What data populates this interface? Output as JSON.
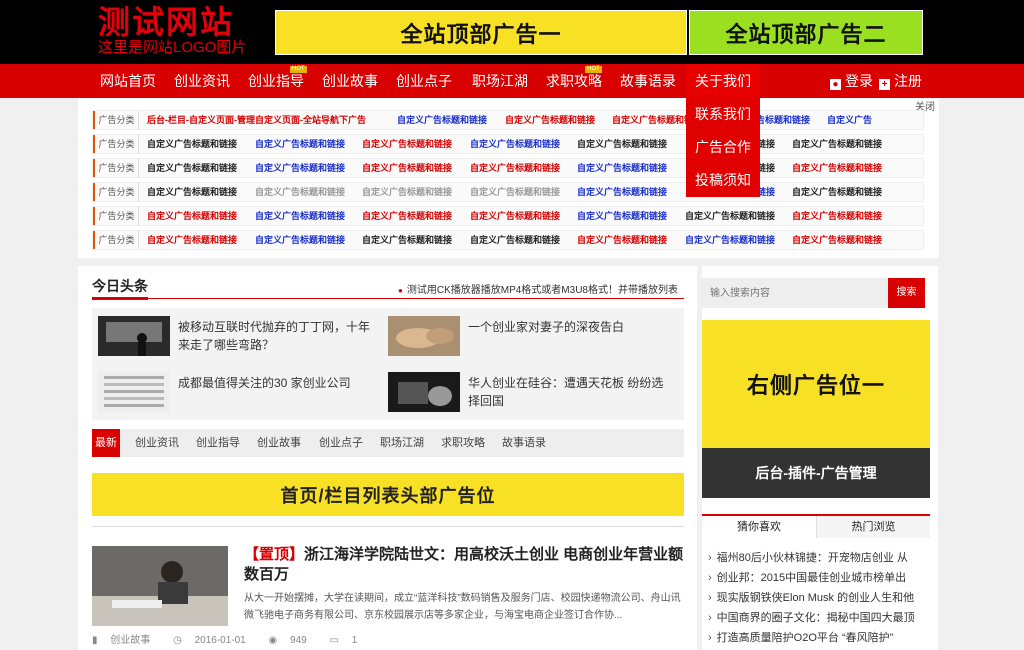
{
  "logo": {
    "title": "测试网站",
    "subtitle": "这里是网站LOGO图片"
  },
  "top_ads": {
    "ad1": "全站顶部广告一",
    "ad2": "全站顶部广告二"
  },
  "nav": {
    "items": [
      "网站首页",
      "创业资讯",
      "创业指导",
      "创业故事",
      "创业点子",
      "职场江湖",
      "求职攻略",
      "故事语录",
      "关于我们"
    ],
    "hot_tag": "HOT",
    "login": "登录",
    "register": "注册"
  },
  "dropdown": {
    "items": [
      "联系我们",
      "广告合作",
      "投稿须知"
    ]
  },
  "ad_panel": {
    "close": "关闭",
    "category": "广告分类",
    "row1_first": "后台-栏目-自定义页面-管理自定义页面-全站导航下广告",
    "link": "自定义广告标题和链接",
    "short_link": "自定义广告"
  },
  "headlines": {
    "title": "今日头条",
    "ticker": "测试用CK播放器播放MP4格式或者M3U8格式！并带播放列表",
    "items": [
      "被移动互联时代抛弃的丁丁网，十年来走了哪些弯路？",
      "一个创业家对妻子的深夜告白",
      "成都最值得关注的30 家创业公司",
      "华人创业在硅谷：遭遇天花板 纷纷选择回国"
    ]
  },
  "category_bar": {
    "latest": "最新",
    "items": [
      "创业资讯",
      "创业指导",
      "创业故事",
      "创业点子",
      "职场江湖",
      "求职攻略",
      "故事语录"
    ]
  },
  "banner_ad": "首页/栏目列表头部广告位",
  "article": {
    "pin": "【置顶】",
    "title": "浙江海洋学院陆世文：用高校沃土创业 电商创业年营业额数百万",
    "desc": "从大一开始摆摊，大学在读期间，成立“蓝洋科技”数码销售及服务门店、校园快递物流公司、舟山讯微飞驰电子商务有限公司、京东校园展示店等多家企业，与海宝电商企业签订合作协...",
    "category": "创业故事",
    "date": "2016-01-01",
    "views": "949",
    "comments": "1"
  },
  "sidebar": {
    "search_placeholder": "输入搜索内容",
    "search_button": "搜索",
    "ad_title": "右侧广告位一",
    "ad_subtitle": "后台-插件-广告管理",
    "tab1": "猜你喜欢",
    "tab2": "热门浏览",
    "list": [
      "福州80后小伙林锦捷：开宠物店创业 从",
      "创业邦：2015中国最佳创业城市榜单出",
      "现实版钢铁侠Elon Musk 的创业人生和他",
      "中国商界的圈子文化：揭秘中国四大最顶",
      "打造高质量陪护O2O平台 “春风陪护”"
    ]
  }
}
